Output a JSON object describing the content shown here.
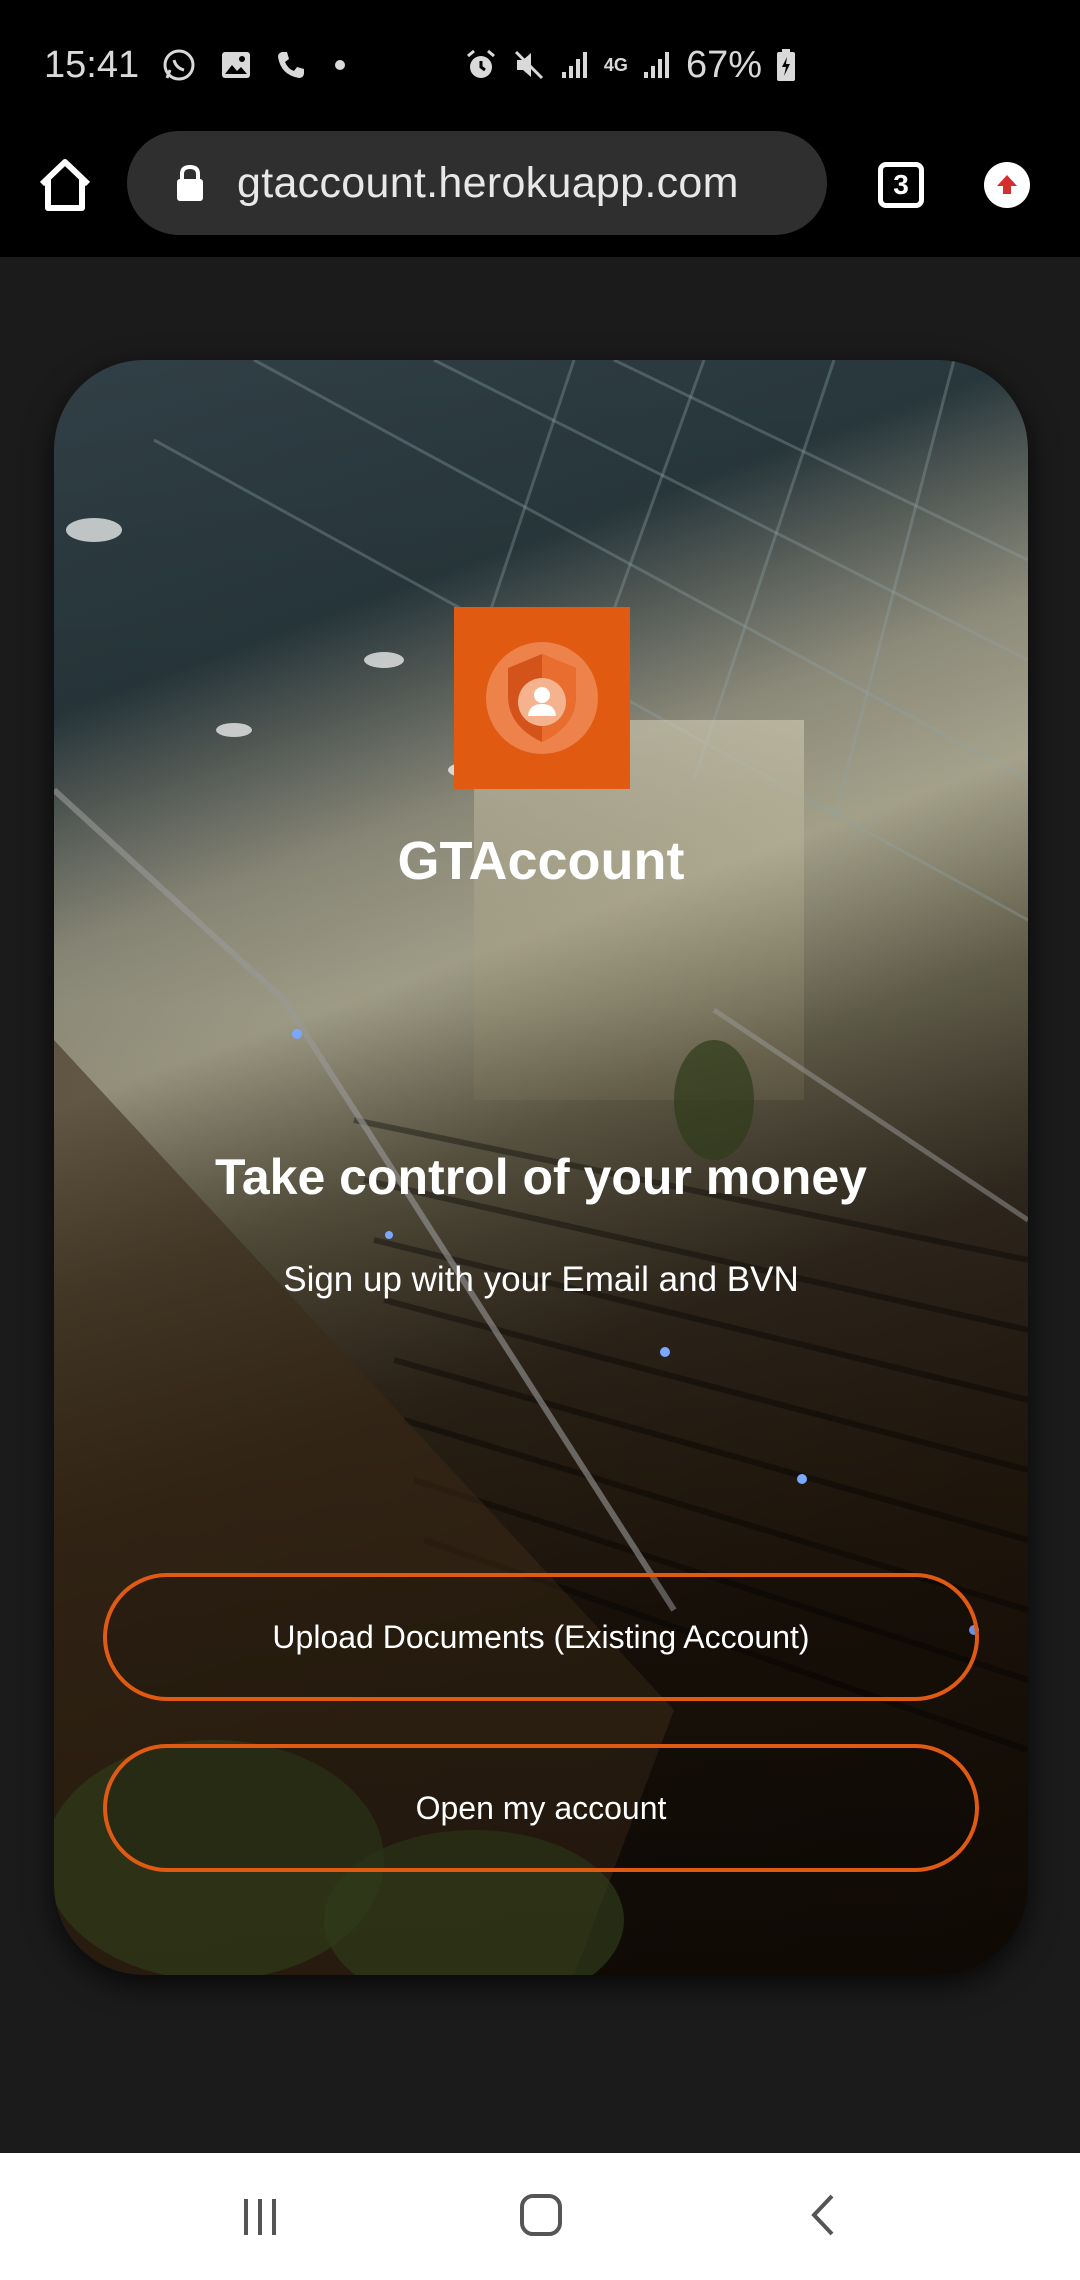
{
  "status_bar": {
    "time": "15:41",
    "battery": "67%",
    "network": "4G"
  },
  "browser": {
    "url": "gtaccount.herokuapp.com",
    "tab_count": "3"
  },
  "app": {
    "brand_name": "GTAccount",
    "headline": "Take control of your money",
    "subheadline": "Sign up with your Email and BVN",
    "upload_button_label": "Upload Documents (Existing Account)",
    "open_button_label": "Open my account"
  },
  "colors": {
    "accent": "#e05a12",
    "page_background": "#1b1b1b",
    "status_bar": "#000000"
  },
  "icons": {
    "status_left": [
      "whatsapp-icon",
      "gallery-icon",
      "phone-icon"
    ],
    "status_right": [
      "alarm-icon",
      "mute-icon",
      "signal-icon",
      "4g-icon",
      "signal-icon",
      "battery-charging-icon"
    ],
    "toolbar": [
      "home-icon",
      "lock-icon",
      "tabs-icon",
      "update-icon"
    ],
    "logo": "shield-user-icon",
    "nav": [
      "recent-apps-icon",
      "home-nav-icon",
      "back-icon"
    ]
  }
}
